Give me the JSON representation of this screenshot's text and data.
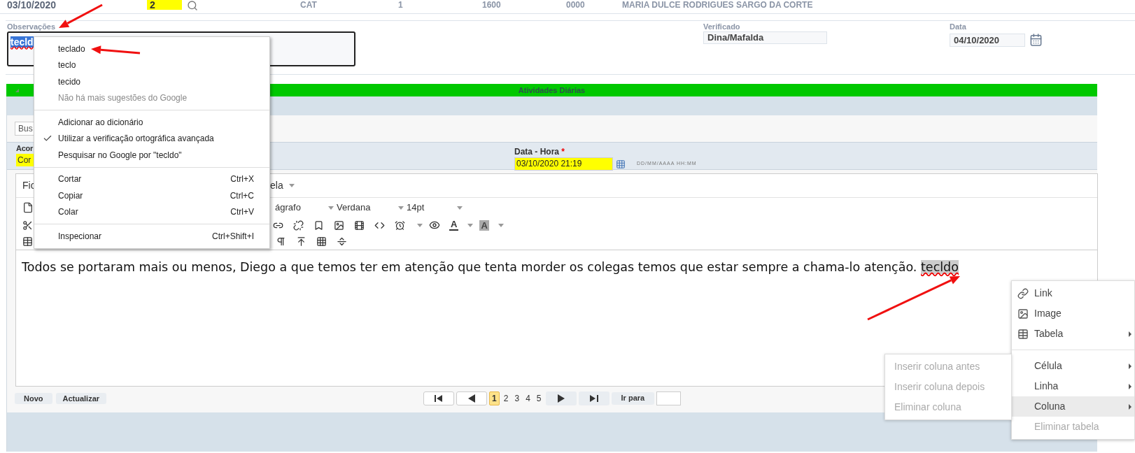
{
  "record_row": {
    "date": "03/10/2020",
    "number": "2",
    "column_3": "CAT",
    "column_4": "1",
    "column_5": "1600",
    "column_6": "0000",
    "name": "MARIA DULCE RODRIGUES SARGO DA CORTE"
  },
  "observations": {
    "label": "Observações",
    "value": "tecld"
  },
  "verified": {
    "label": "Verificado",
    "value": "Dina/Mafalda"
  },
  "date": {
    "label": "Data",
    "value": "04/10/2020"
  },
  "section": {
    "title": "Atividades Diárias",
    "expanded": true
  },
  "search": {
    "placeholder": "Bus"
  },
  "activity_form": {
    "field_1": {
      "label": "Acor",
      "value": "Cor"
    },
    "datetime": {
      "label": "Data - Hora",
      "required_mark": "*",
      "value": "03/10/2020 21:19",
      "hint": "DD/MM/AAAA HH:MM"
    }
  },
  "editor": {
    "menu": [
      "Fic",
      "ela"
    ],
    "block_format": "ágrafo",
    "font": "Verdana",
    "size": "14pt",
    "text_color_glyph": "A",
    "background_color_glyph": "A",
    "content": "Todos se portaram mais ou menos, Diego a que temos ter em atenção que tenta morder os colegas temos que estar sempre a chama-lo atenção.",
    "selected_word": "tecldo"
  },
  "buttons": [
    "Novo",
    "Actualizar"
  ],
  "pagination": {
    "pages": [
      {
        "label": "1",
        "selected": true
      },
      {
        "label": "2",
        "selected": false
      },
      {
        "label": "3",
        "selected": false
      },
      {
        "label": "4",
        "selected": false
      },
      {
        "label": "5",
        "selected": false
      }
    ],
    "go_to": "Ir para"
  },
  "spell_menu": {
    "items": [
      {
        "kind": "item",
        "label": "teclado",
        "checked": false,
        "disabled": false
      },
      {
        "kind": "item",
        "label": "teclo",
        "checked": false,
        "disabled": false
      },
      {
        "kind": "item",
        "label": "tecido",
        "checked": false,
        "disabled": false
      },
      {
        "kind": "item",
        "label": "Não há mais sugestões do Google",
        "checked": false,
        "disabled": true
      },
      {
        "kind": "separator"
      },
      {
        "kind": "item",
        "label": "Adicionar ao dicionário",
        "checked": false,
        "disabled": false
      },
      {
        "kind": "item",
        "label": "Utilizar a verificação ortográfica avançada",
        "checked": true,
        "disabled": false
      },
      {
        "kind": "item",
        "label": "Pesquisar no Google por \"tecldo\"",
        "checked": false,
        "disabled": false
      },
      {
        "kind": "separator"
      },
      {
        "kind": "item",
        "label": "Cortar",
        "shortcut": "Ctrl+X",
        "checked": false,
        "disabled": false
      },
      {
        "kind": "item",
        "label": "Copiar",
        "shortcut": "Ctrl+C",
        "checked": false,
        "disabled": false
      },
      {
        "kind": "item",
        "label": "Colar",
        "shortcut": "Ctrl+V",
        "checked": false,
        "disabled": false
      },
      {
        "kind": "separator"
      },
      {
        "kind": "item",
        "label": "Inspecionar",
        "shortcut": "Ctrl+Shift+I",
        "checked": false,
        "disabled": false
      }
    ]
  },
  "editor_menu": {
    "items": [
      {
        "kind": "icon_item",
        "label": "Link",
        "disabled": false,
        "submenu": false,
        "selected": false
      },
      {
        "kind": "icon_item",
        "label": "Image",
        "disabled": false,
        "submenu": false,
        "selected": false
      },
      {
        "kind": "icon_item",
        "label": "Tabela",
        "disabled": false,
        "submenu": true,
        "selected": false
      },
      {
        "kind": "separator"
      },
      {
        "kind": "item",
        "label": "Célula",
        "disabled": false,
        "submenu": true,
        "selected": false
      },
      {
        "kind": "item",
        "label": "Linha",
        "disabled": false,
        "submenu": true,
        "selected": false
      },
      {
        "kind": "item",
        "label": "Coluna",
        "disabled": false,
        "submenu": true,
        "selected": true
      },
      {
        "kind": "item",
        "label": "Eliminar tabela",
        "disabled": true,
        "submenu": false,
        "selected": false
      }
    ]
  },
  "column_submenu": {
    "items": [
      {
        "label": "Inserir coluna antes",
        "disabled": true
      },
      {
        "label": "Inserir coluna depois",
        "disabled": true
      },
      {
        "label": "Eliminar coluna",
        "disabled": true
      }
    ]
  }
}
